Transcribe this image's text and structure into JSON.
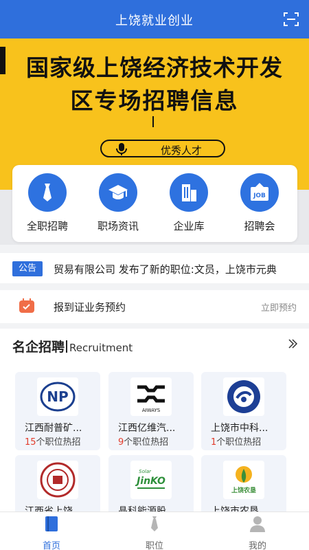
{
  "header": {
    "title": "上饶就业创业",
    "scan_icon": "scan-icon"
  },
  "banner": {
    "line1": "国家级上饶经济技术开发",
    "line2": "区专场招聘信息",
    "pill_text": "优秀人才",
    "slide_count": 5,
    "active_slide": 4
  },
  "menu": {
    "items": [
      {
        "label": "全职招聘",
        "icon": "tie-icon"
      },
      {
        "label": "职场资讯",
        "icon": "graduation-cap-icon"
      },
      {
        "label": "企业库",
        "icon": "building-icon"
      },
      {
        "label": "招聘会",
        "icon": "job-board-icon"
      }
    ]
  },
  "notice": {
    "tag": "公告",
    "text": "贸易有限公司 发布了新的职位:文员，上饶市元典"
  },
  "appointment": {
    "text": "报到证业务预约",
    "link": "立即预约"
  },
  "recruit": {
    "title": "名企招聘",
    "subtitle": "Recruitment",
    "companies": [
      {
        "name": "江西耐普矿...",
        "count": "15",
        "suffix": "个职位热招",
        "logo": "np-logo"
      },
      {
        "name": "江西亿维汽...",
        "count": "9",
        "suffix": "个职位热招",
        "logo": "aiways-logo",
        "logo_text": "AIWAYS"
      },
      {
        "name": "上饶市中科...",
        "count": "1",
        "suffix": "个职位热招",
        "logo": "zhongke-logo"
      },
      {
        "name": "江西省上饶...",
        "count": "",
        "suffix": "",
        "logo": "school-seal-logo"
      },
      {
        "name": "晶科能源股...",
        "count": "",
        "suffix": "",
        "logo": "jinko-logo",
        "logo_text": "JinKO",
        "logo_sub": "Solar"
      },
      {
        "name": "上饶市农垦...",
        "count": "",
        "suffix": "",
        "logo": "nongken-logo",
        "logo_text": "上饶农垦"
      }
    ]
  },
  "tabbar": {
    "tabs": [
      {
        "label": "首页",
        "icon": "book-icon",
        "active": true
      },
      {
        "label": "职位",
        "icon": "tie-icon",
        "active": false
      },
      {
        "label": "我的",
        "icon": "user-icon",
        "active": false
      }
    ]
  },
  "colors": {
    "primary": "#2f6fdc",
    "banner": "#f8c21c",
    "highlight": "#e23c2c"
  }
}
